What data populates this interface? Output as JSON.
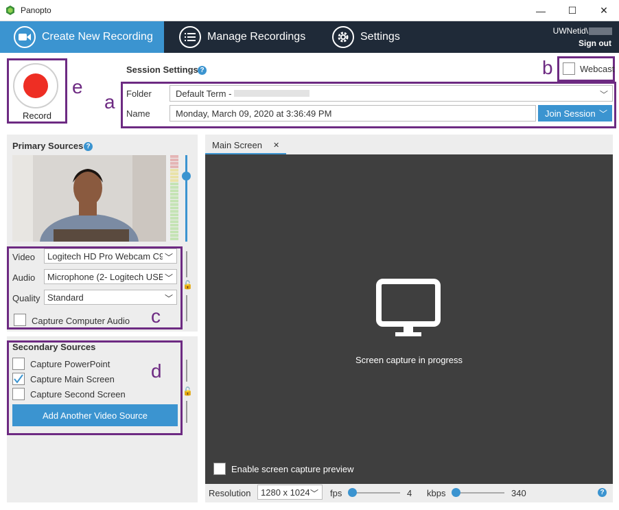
{
  "window": {
    "title": "Panopto",
    "minimize": "—",
    "maximize": "☐",
    "close": "✕"
  },
  "nav": {
    "tabs": [
      {
        "label": "Create New Recording",
        "icon": "video-camera-icon"
      },
      {
        "label": "Manage Recordings",
        "icon": "list-icon"
      },
      {
        "label": "Settings",
        "icon": "gear-icon"
      }
    ],
    "user_id": "UWNetid\\",
    "sign_out": "Sign out"
  },
  "record": {
    "label": "Record"
  },
  "annotations": {
    "a": "a",
    "b": "b",
    "c": "c",
    "d": "d",
    "e": "e"
  },
  "session": {
    "title": "Session Settings",
    "help": "?",
    "webcast_label": "Webcast",
    "folder_label": "Folder",
    "folder_value": "Default Term -",
    "name_label": "Name",
    "name_value": "Monday, March 09, 2020 at 3:36:49 PM",
    "join_label": "Join Session"
  },
  "primary": {
    "title": "Primary Sources",
    "video_label": "Video",
    "video_value": "Logitech HD Pro Webcam C9..",
    "audio_label": "Audio",
    "audio_value": "Microphone (2- Logitech USB",
    "quality_label": "Quality",
    "quality_value": "Standard",
    "capture_audio_label": "Capture Computer Audio"
  },
  "secondary": {
    "title": "Secondary Sources",
    "items": [
      {
        "label": "Capture PowerPoint",
        "checked": false
      },
      {
        "label": "Capture Main Screen",
        "checked": true
      },
      {
        "label": "Capture Second Screen",
        "checked": false
      }
    ],
    "add_label": "Add Another Video Source"
  },
  "preview": {
    "tab_label": "Main Screen",
    "tab_close": "✕",
    "message": "Screen capture in progress",
    "enable_preview_label": "Enable screen capture preview"
  },
  "bottom": {
    "resolution_label": "Resolution",
    "resolution_value": "1280 x 1024",
    "fps_label": "fps",
    "fps_value": "4",
    "kbps_label": "kbps",
    "kbps_value": "340",
    "help": "?"
  },
  "colors": {
    "accent": "#3b94d0",
    "nav_bg": "#1f2a38",
    "annotation": "#6d2a82",
    "record": "#ee2e24"
  }
}
